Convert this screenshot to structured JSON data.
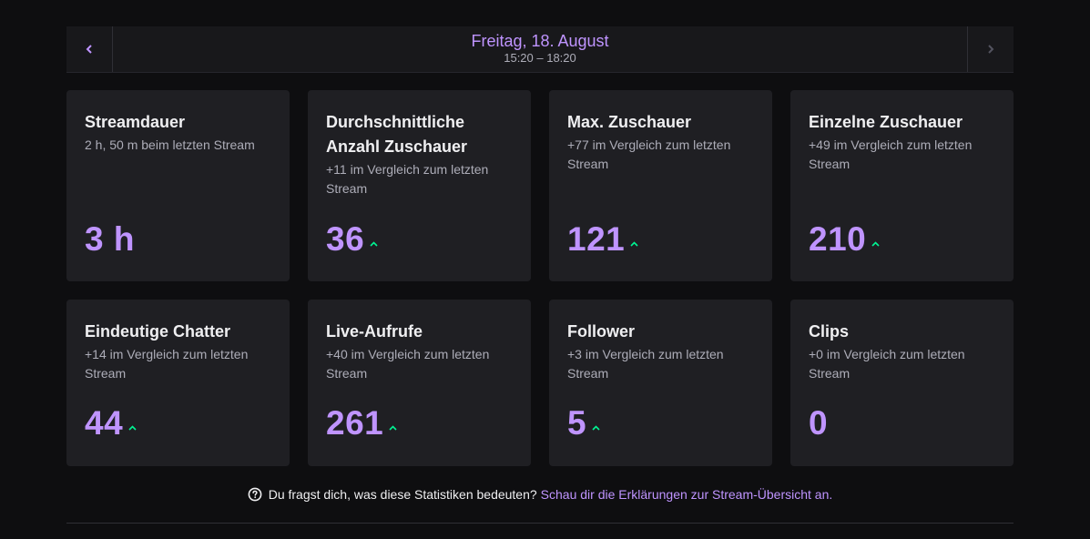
{
  "datebar": {
    "title": "Freitag, 18. August",
    "time_range": "15:20 – 18:20"
  },
  "accent_color": "#bf94ff",
  "trend_up_color": "#00f593",
  "cards": [
    {
      "title": "Streamdauer",
      "subtitle": "2 h, 50 m beim letzten Stream",
      "value": "3 h",
      "trend": "none"
    },
    {
      "title": "Durchschnittliche Anzahl Zuschauer",
      "subtitle": "+11 im Vergleich zum letzten Stream",
      "value": "36",
      "trend": "up"
    },
    {
      "title": "Max. Zuschauer",
      "subtitle": "+77 im Vergleich zum letzten Stream",
      "value": "121",
      "trend": "up"
    },
    {
      "title": "Einzelne Zuschauer",
      "subtitle": "+49 im Vergleich zum letzten Stream",
      "value": "210",
      "trend": "up"
    },
    {
      "title": "Eindeutige Chatter",
      "subtitle": "+14 im Vergleich zum letzten Stream",
      "value": "44",
      "trend": "up"
    },
    {
      "title": "Live-Aufrufe",
      "subtitle": "+40 im Vergleich zum letzten Stream",
      "value": "261",
      "trend": "up"
    },
    {
      "title": "Follower",
      "subtitle": "+3 im Vergleich zum letzten Stream",
      "value": "5",
      "trend": "up"
    },
    {
      "title": "Clips",
      "subtitle": "+0 im Vergleich zum letzten Stream",
      "value": "0",
      "trend": "none"
    }
  ],
  "footer": {
    "question": "Du fragst dich, was diese Statistiken bedeuten?",
    "link_text": "Schau dir die Erklärungen zur Stream-Übersicht an."
  }
}
